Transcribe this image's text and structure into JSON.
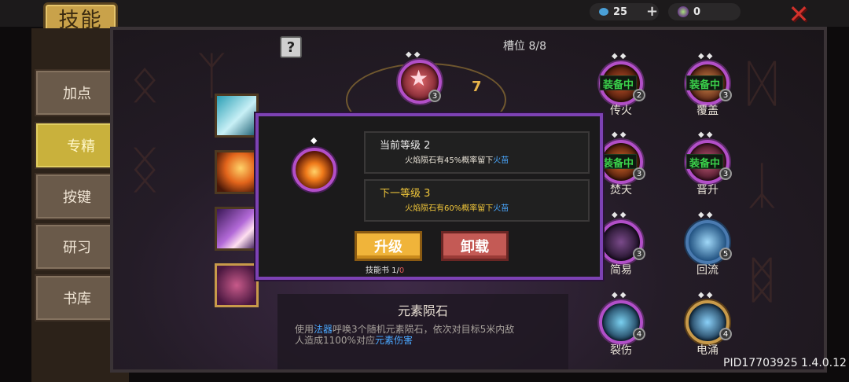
{
  "header": {
    "title": "技能",
    "gem_count": "25",
    "plus": "+",
    "orb_count": "0",
    "close": "✕"
  },
  "tabs": [
    {
      "label": "加点",
      "active": false
    },
    {
      "label": "专精",
      "active": true
    },
    {
      "label": "按键",
      "active": false
    },
    {
      "label": "研习",
      "active": false
    },
    {
      "label": "书库",
      "active": false
    }
  ],
  "panel": {
    "help": "?",
    "slots": "槽位 8/8",
    "mark": "7"
  },
  "grid": [
    {
      "label": "传火",
      "level": "2",
      "equipped": "装备中"
    },
    {
      "label": "覆盖",
      "level": "3",
      "equipped": "装备中"
    },
    {
      "label": "焚天",
      "level": "3",
      "equipped": "装备中"
    },
    {
      "label": "晋升",
      "level": "3",
      "equipped": "装备中"
    },
    {
      "label": "简易",
      "level": "3",
      "equipped": ""
    },
    {
      "label": "回流",
      "level": "5",
      "equipped": ""
    },
    {
      "label": "裂伤",
      "level": "4",
      "equipped": ""
    },
    {
      "label": "电涌",
      "level": "4",
      "equipped": ""
    }
  ],
  "top_node_level": "3",
  "modal": {
    "current_title": "当前等级 2",
    "current_desc_a": "火焰陨石有45%概率留下",
    "current_desc_b": "火苗",
    "next_title": "下一等级 3",
    "next_desc_a": "火焰陨石有60%概率留下",
    "next_desc_b": "火苗",
    "upgrade_label": "升级",
    "unload_label": "卸载",
    "book_label": "技能书 1/",
    "book_have": "0"
  },
  "description": {
    "name": "元素陨石",
    "l1_a": "使用",
    "l1_b": "法器",
    "l1_c": "呼唤3个随机元素陨石，依次对目标5米内敌",
    "l2_a": "人造成1100%对应",
    "l2_b": "元素伤害"
  },
  "version": "PID17703925 1.4.0.12",
  "colors": {
    "accent_purple": "#7d42b4",
    "fire_blue": "#4aa8ff",
    "equipped_green": "#3bd14b",
    "upgrade_gold": "#f0b43a",
    "unload_red": "#c45a55"
  }
}
